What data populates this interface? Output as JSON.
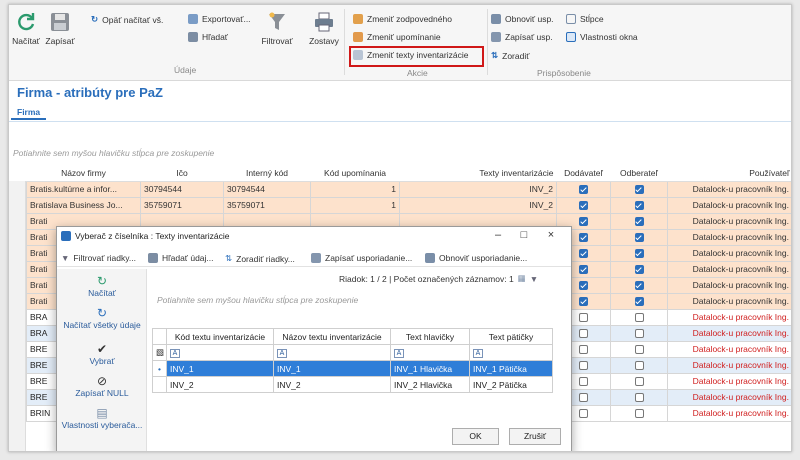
{
  "ribbon": {
    "load": "Načítať",
    "save": "Zapísať",
    "reload_all": "Opäť načítať vš.",
    "export": "Exportovať...",
    "search": "Hľadať",
    "filter": "Filtrovať",
    "reports": "Zostavy",
    "group_data": "Údaje",
    "change_responsible": "Zmeniť zodpovedného",
    "change_reminder": "Zmeniť upomínanie",
    "change_inventory_texts": "Zmeniť texty inventarizácie",
    "group_actions": "Akcie",
    "refresh_layout": "Obnoviť usp.",
    "columns": "Stĺpce",
    "write_layout": "Zapísať usp.",
    "window_props": "Vlastnosti okna",
    "sort": "Zoradiť",
    "group_customize": "Prispôsobenie"
  },
  "page": {
    "title": "Firma - atribúty pre PaZ",
    "tab": "Firma",
    "group_hint": "Potiahnite sem myšou hlavičku stĺpca pre zoskupenie"
  },
  "grid": {
    "headers": [
      "Názov firmy",
      "Ičo",
      "Interný kód",
      "Kód upomínania",
      "Texty inventarizácie",
      "Dodávateľ",
      "Odberateľ",
      "Používateľ"
    ],
    "rows": [
      {
        "name": "Bratis.kultúrne a infor...",
        "ico": "30794544",
        "code": "30794544",
        "rem": "1",
        "inv": "INV_2",
        "sup": true,
        "cust": true,
        "user": "Datalock-u pracovník Ing.",
        "style": "orange"
      },
      {
        "name": "Bratislava Business Jo...",
        "ico": "35759071",
        "code": "35759071",
        "rem": "1",
        "inv": "INV_2",
        "sup": true,
        "cust": true,
        "user": "Datalock-u pracovník Ing.",
        "style": "orange"
      },
      {
        "name": "Brati",
        "ico": "",
        "code": "",
        "rem": "",
        "inv": "",
        "sup": true,
        "cust": true,
        "user": "Datalock-u pracovník Ing.",
        "style": "orange"
      },
      {
        "name": "Brati",
        "ico": "",
        "code": "",
        "rem": "",
        "inv": "",
        "sup": true,
        "cust": true,
        "user": "Datalock-u pracovník Ing.",
        "style": "orange"
      },
      {
        "name": "Brati",
        "ico": "",
        "code": "",
        "rem": "",
        "inv": "",
        "sup": true,
        "cust": true,
        "user": "Datalock-u pracovník Ing.",
        "style": "orange"
      },
      {
        "name": "Brati",
        "ico": "",
        "code": "",
        "rem": "",
        "inv": "",
        "sup": true,
        "cust": true,
        "user": "Datalock-u pracovník Ing.",
        "style": "orange"
      },
      {
        "name": "Brati",
        "ico": "",
        "code": "",
        "rem": "",
        "inv": "",
        "sup": true,
        "cust": true,
        "user": "Datalock-u pracovník Ing.",
        "style": "orange"
      },
      {
        "name": "Brati",
        "ico": "",
        "code": "",
        "rem": "",
        "inv": "",
        "sup": true,
        "cust": true,
        "user": "Datalock-u pracovník Ing.",
        "style": "orange"
      },
      {
        "name": "BRA",
        "ico": "",
        "code": "",
        "rem": "",
        "inv": "",
        "sup": false,
        "cust": false,
        "user": "Datalock-u pracovník Ing.",
        "style": "plain"
      },
      {
        "name": "BRA",
        "ico": "",
        "code": "",
        "rem": "",
        "inv": "",
        "sup": false,
        "cust": false,
        "user": "Datalock-u pracovník Ing.",
        "style": "blue"
      },
      {
        "name": "BRE",
        "ico": "",
        "code": "",
        "rem": "",
        "inv": "",
        "sup": false,
        "cust": false,
        "user": "Datalock-u pracovník Ing.",
        "style": "plain"
      },
      {
        "name": "BRE",
        "ico": "",
        "code": "",
        "rem": "",
        "inv": "",
        "sup": false,
        "cust": false,
        "user": "Datalock-u pracovník Ing.",
        "style": "blue"
      },
      {
        "name": "BRE",
        "ico": "",
        "code": "",
        "rem": "",
        "inv": "",
        "sup": false,
        "cust": false,
        "user": "Datalock-u pracovník Ing.",
        "style": "plain"
      },
      {
        "name": "BRE",
        "ico": "",
        "code": "",
        "rem": "",
        "inv": "",
        "sup": false,
        "cust": false,
        "user": "Datalock-u pracovník Ing.",
        "style": "blue"
      },
      {
        "name": "BRIN",
        "ico": "",
        "code": "",
        "rem": "",
        "inv": "",
        "sup": false,
        "cust": false,
        "user": "Datalock-u pracovník Ing.",
        "style": "plain"
      }
    ]
  },
  "dialog": {
    "title": "Vyberač z číselníka : Texty inventarizácie",
    "toolbar": [
      "Filtrovať riadky...",
      "Hľadať údaj...",
      "Zoradiť riadky...",
      "Zapísať usporiadanie...",
      "Obnoviť usporiadanie..."
    ],
    "side": [
      "Načítať",
      "Načítať všetky údaje",
      "Vybrať",
      "Zapísať NULL",
      "Vlastnosti vyberača..."
    ],
    "status": "Riadok: 1 / 2 | Počet označených záznamov: 1",
    "group_hint": "Potiahnite sem myšou hlavičku stĺpca pre zoskupenie",
    "headers": [
      "Kód textu inventarizácie",
      "Názov textu inventarizácie",
      "Text hlavičky",
      "Text pätičky"
    ],
    "rows": [
      [
        "INV_1",
        "INV_1",
        "INV_1 Hlavička",
        "INV_1 Pätička"
      ],
      [
        "INV_2",
        "INV_2",
        "INV_2 Hlavička",
        "INV_2 Pätička"
      ]
    ],
    "ok": "OK",
    "close": "Zrušiť"
  }
}
